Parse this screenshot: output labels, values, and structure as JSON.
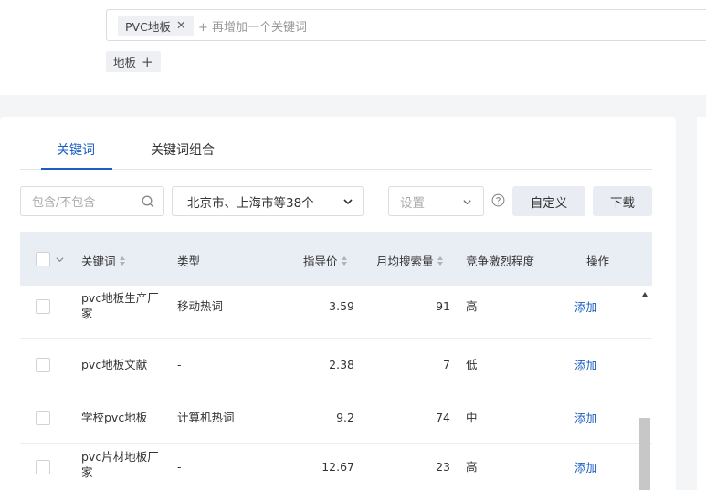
{
  "search": {
    "chip_label": "PVC地板",
    "chip_close": "✕",
    "add_more": "+ 再增加一个关键词",
    "suggested_tag": "地板",
    "suggested_plus": "+"
  },
  "tabs": [
    {
      "label": "关键词",
      "active": true
    },
    {
      "label": "关键词组合",
      "active": false
    }
  ],
  "filters": {
    "include_placeholder": "包含/不包含",
    "region_value": "北京市、上海市等38个",
    "settings_placeholder": "设置",
    "custom_button": "自定义",
    "download_button": "下载"
  },
  "table": {
    "headers": {
      "keyword": "关键词",
      "type": "类型",
      "price": "指导价",
      "monthly_search": "月均搜索量",
      "competition": "竞争激烈程度",
      "action": "操作"
    },
    "rows": [
      {
        "keyword_line1": "pvc地板生产厂",
        "keyword_line2": "家",
        "type": "移动热词",
        "price": "3.59",
        "monthly_search": "91",
        "competition": "高",
        "action": "添加"
      },
      {
        "keyword_line1": "pvc地板文献",
        "keyword_line2": "",
        "type": "-",
        "price": "2.38",
        "monthly_search": "7",
        "competition": "低",
        "action": "添加"
      },
      {
        "keyword_line1": "学校pvc地板",
        "keyword_line2": "",
        "type": "计算机热词",
        "price": "9.2",
        "monthly_search": "74",
        "competition": "中",
        "action": "添加"
      },
      {
        "keyword_line1": "pvc片材地板厂",
        "keyword_line2": "家",
        "type": "-",
        "price": "12.67",
        "monthly_search": "23",
        "competition": "高",
        "action": "添加"
      }
    ]
  },
  "colors": {
    "accent": "#1a5fc0",
    "header_bg": "#e9edf4"
  }
}
